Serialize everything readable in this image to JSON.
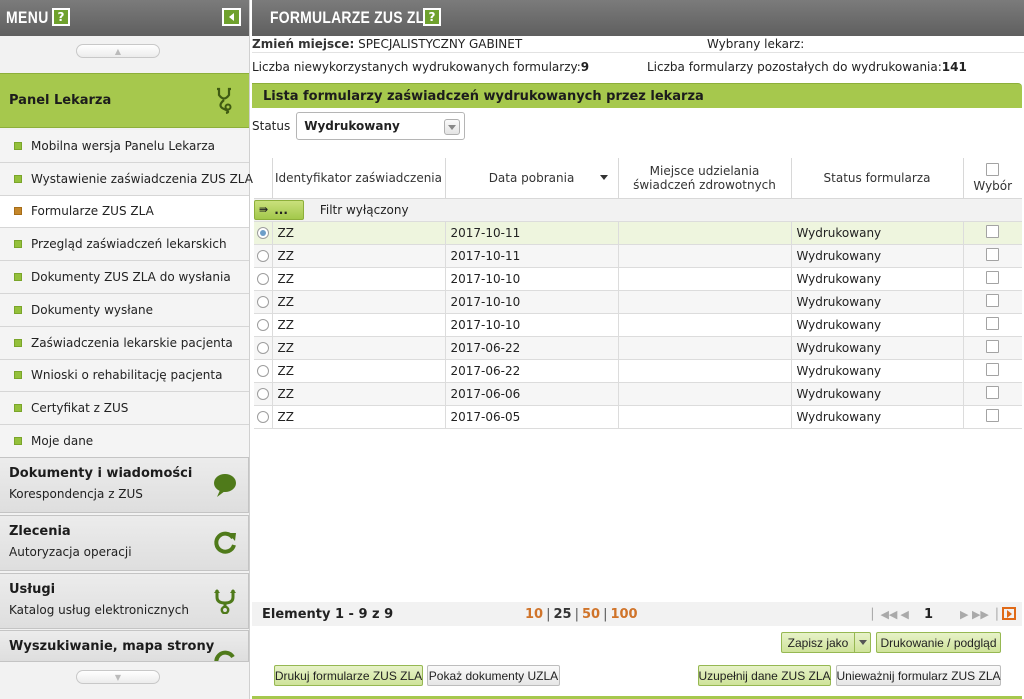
{
  "sidebar": {
    "title": "MENU",
    "help": "?",
    "panel": {
      "label": "Panel Lekarza"
    },
    "items": [
      {
        "label": "Mobilna wersja Panelu Lekarza",
        "active": false
      },
      {
        "label": "Wystawienie zaświadczenia ZUS ZLA",
        "active": false
      },
      {
        "label": "Formularze ZUS ZLA",
        "active": true
      },
      {
        "label": "Przegląd zaświadczeń lekarskich",
        "active": false
      },
      {
        "label": "Dokumenty ZUS ZLA do wysłania",
        "active": false
      },
      {
        "label": "Dokumenty wysłane",
        "active": false
      },
      {
        "label": "Zaświadczenia lekarskie pacjenta",
        "active": false
      },
      {
        "label": "Wnioski o rehabilitację pacjenta",
        "active": false
      },
      {
        "label": "Certyfikat z ZUS",
        "active": false
      },
      {
        "label": "Moje dane",
        "active": false
      }
    ],
    "sections": [
      {
        "title": "Dokumenty i wiadomości",
        "sub": "Korespondencja z ZUS",
        "icon": "speech-bubble-icon"
      },
      {
        "title": "Zlecenia",
        "sub": "Autoryzacja operacji",
        "icon": "refresh-icon"
      },
      {
        "title": "Usługi",
        "sub": "Katalog usług elektronicznych",
        "icon": "services-fork-icon"
      },
      {
        "title": "Wyszukiwanie, mapa strony",
        "sub": "",
        "icon": "search-refresh-icon"
      }
    ]
  },
  "main": {
    "title": "FORMULARZE ZUS ZLA",
    "help": "?",
    "info": {
      "place_label": "Zmień miejsce:",
      "place_value": "SPECJALISTYCZNY GABINET",
      "doctor_label": "Wybrany lekarz:",
      "unused_label": "Liczba niewykorzystanych wydrukowanych formularzy:",
      "unused_value": "9",
      "remaining_label": "Liczba formularzy pozostałych do wydrukowania:",
      "remaining_value": "141"
    },
    "list_title": "Lista formularzy zaświadczeń wydrukowanych przez lekarza",
    "status": {
      "label": "Status",
      "value": "Wydrukowany"
    },
    "table": {
      "columns": [
        "Identyfikator zaświadczenia",
        "Data pobrania",
        "Miejsce udzielania świadczeń zdrowotnych",
        "Status formularza",
        "Wybór"
      ],
      "filter_button": "...",
      "filter_text": "Filtr wyłączony",
      "rows": [
        {
          "id": "ZZ",
          "date": "2017-10-11",
          "place": "",
          "status": "Wydrukowany",
          "selected": true
        },
        {
          "id": "ZZ",
          "date": "2017-10-11",
          "place": "",
          "status": "Wydrukowany",
          "selected": false
        },
        {
          "id": "ZZ",
          "date": "2017-10-10",
          "place": "",
          "status": "Wydrukowany",
          "selected": false
        },
        {
          "id": "ZZ",
          "date": "2017-10-10",
          "place": "",
          "status": "Wydrukowany",
          "selected": false
        },
        {
          "id": "ZZ",
          "date": "2017-10-10",
          "place": "",
          "status": "Wydrukowany",
          "selected": false
        },
        {
          "id": "ZZ",
          "date": "2017-06-22",
          "place": "",
          "status": "Wydrukowany",
          "selected": false
        },
        {
          "id": "ZZ",
          "date": "2017-06-22",
          "place": "",
          "status": "Wydrukowany",
          "selected": false
        },
        {
          "id": "ZZ",
          "date": "2017-06-06",
          "place": "",
          "status": "Wydrukowany",
          "selected": false
        },
        {
          "id": "ZZ",
          "date": "2017-06-05",
          "place": "",
          "status": "Wydrukowany",
          "selected": false
        }
      ]
    },
    "pager": {
      "elements": "Elementy 1 - 9 z 9",
      "sizes": [
        "10",
        "25",
        "50",
        "100"
      ],
      "current_size": "25",
      "page": "1"
    },
    "buttons": {
      "save_as": "Zapisz jako",
      "print_preview": "Drukowanie / podgląd",
      "print_forms": "Drukuj formularze ZUS ZLA",
      "show_uzla": "Pokaż dokumenty UZLA",
      "fill_data": "Uzupełnij dane ZUS ZLA",
      "cancel_form": "Unieważnij formularz ZUS ZLA"
    }
  },
  "colors": {
    "accent_green": "#a6c84d",
    "header_grey": "#6b6b6b",
    "link_orange": "#d0742a"
  }
}
